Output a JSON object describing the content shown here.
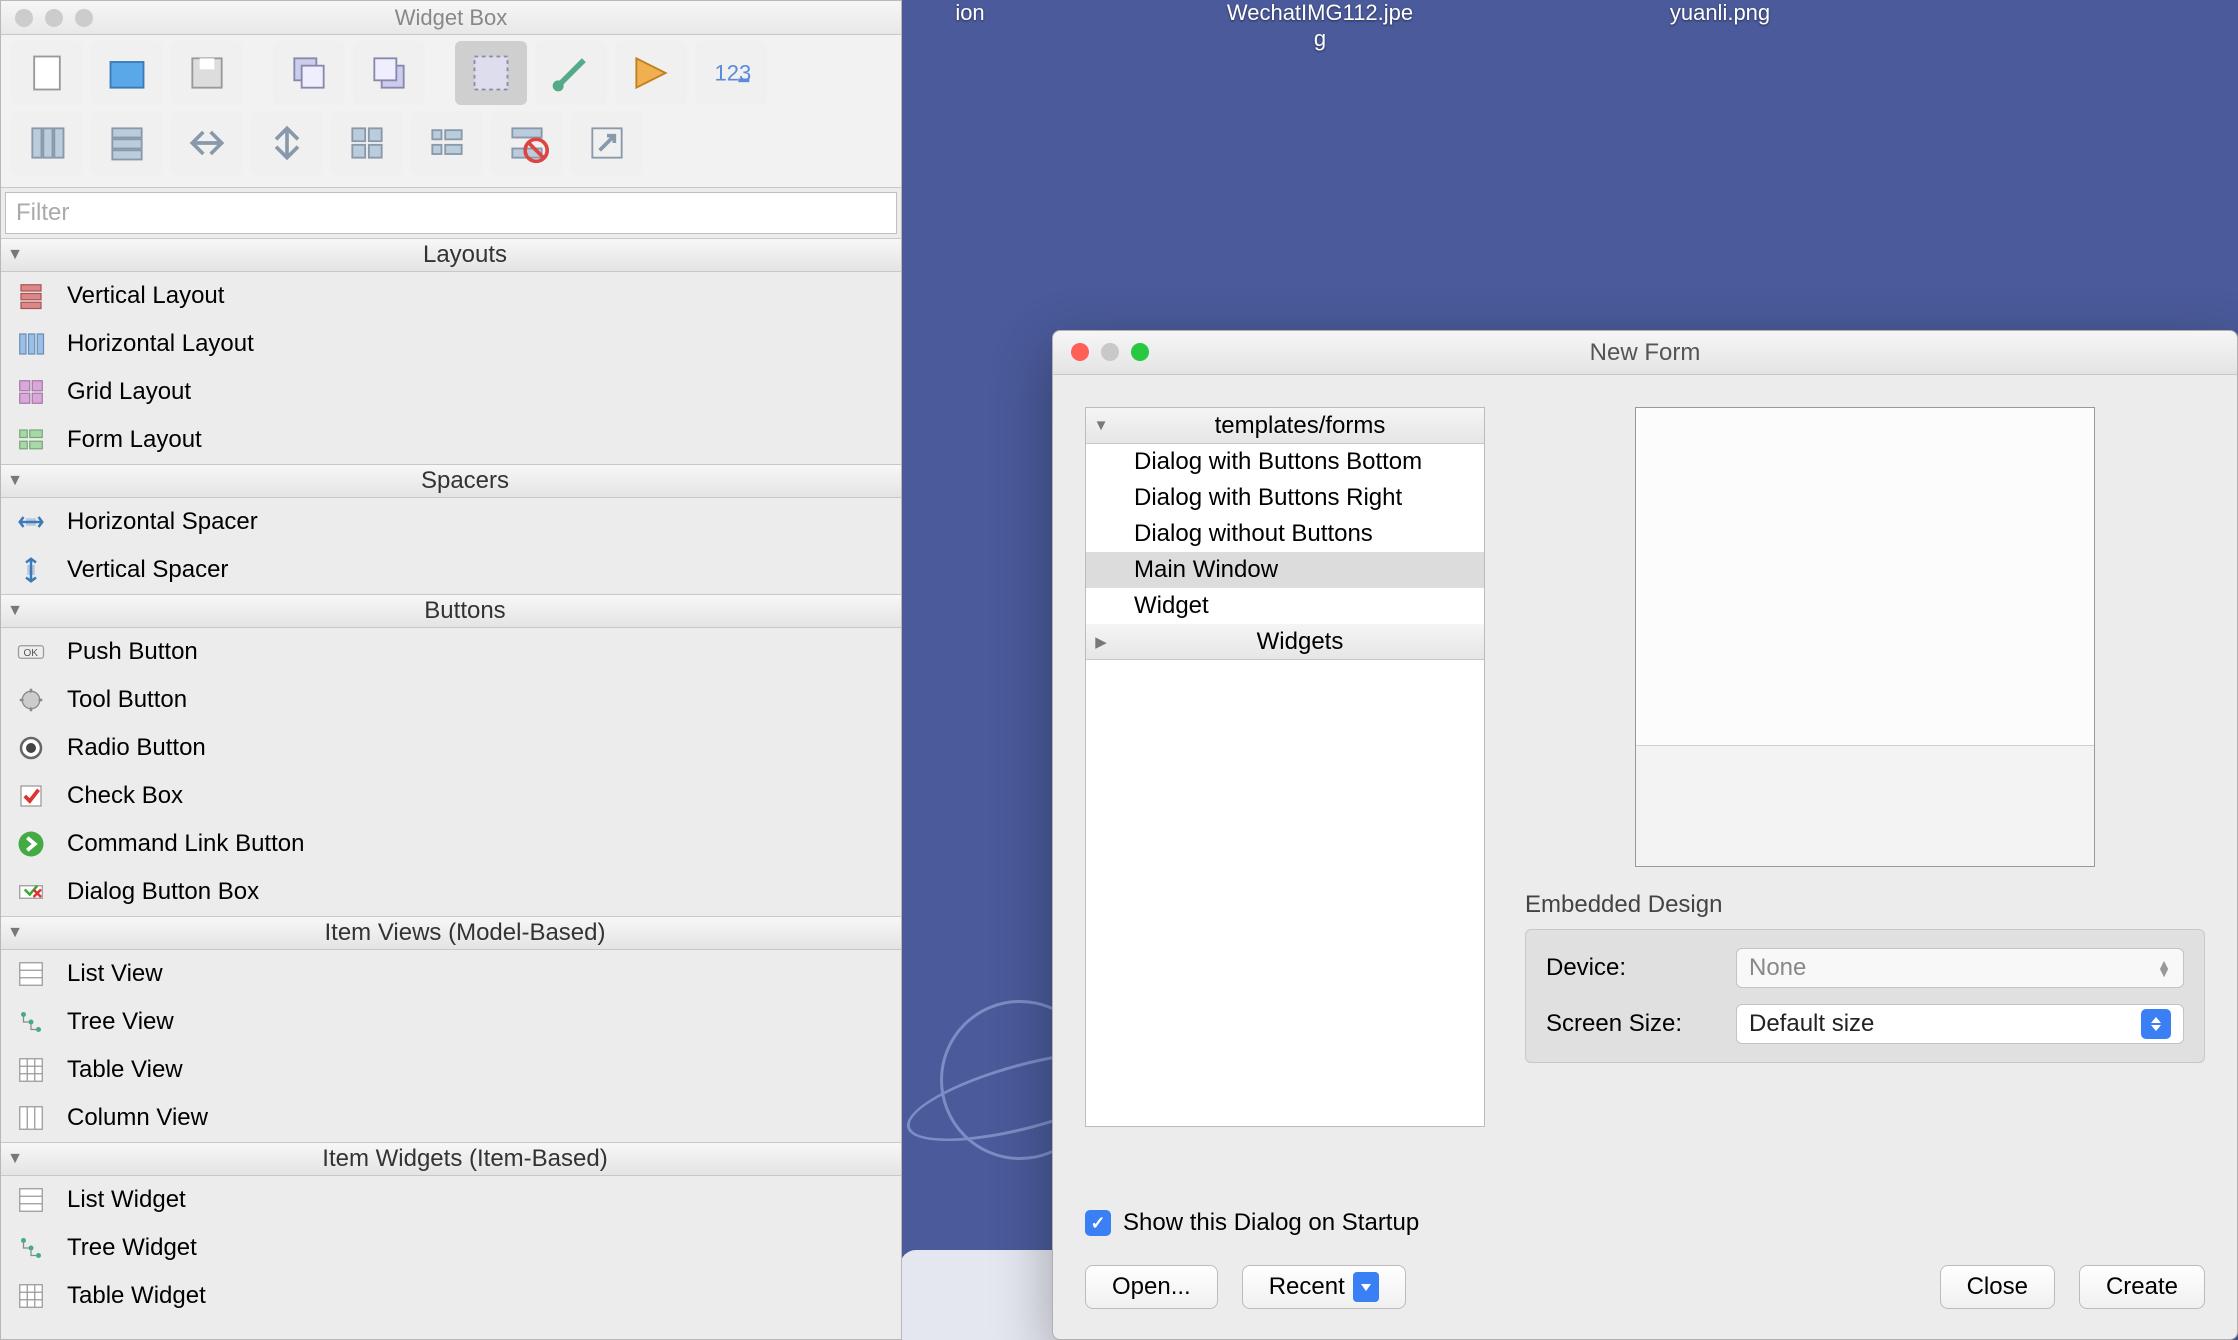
{
  "desktop": {
    "files": [
      {
        "name_top": "ion"
      },
      {
        "name_top": "WechatIMG112.jpe",
        "name_bot": "g"
      },
      {
        "name_top": "yuanli.png"
      }
    ]
  },
  "widget_window": {
    "title": "Widget Box",
    "filter_placeholder": "Filter",
    "categories": [
      {
        "name": "Layouts",
        "items": [
          "Vertical Layout",
          "Horizontal Layout",
          "Grid Layout",
          "Form Layout"
        ]
      },
      {
        "name": "Spacers",
        "items": [
          "Horizontal Spacer",
          "Vertical Spacer"
        ]
      },
      {
        "name": "Buttons",
        "items": [
          "Push Button",
          "Tool Button",
          "Radio Button",
          "Check Box",
          "Command Link Button",
          "Dialog Button Box"
        ]
      },
      {
        "name": "Item Views (Model-Based)",
        "items": [
          "List View",
          "Tree View",
          "Table View",
          "Column View"
        ]
      },
      {
        "name": "Item Widgets (Item-Based)",
        "items": [
          "List Widget",
          "Tree Widget",
          "Table Widget"
        ]
      }
    ]
  },
  "dialog": {
    "title": "New Form",
    "tree_header": "templates/forms",
    "tree_items": [
      "Dialog with Buttons Bottom",
      "Dialog with Buttons Right",
      "Dialog without Buttons",
      "Main Window",
      "Widget"
    ],
    "tree_selected": "Main Window",
    "tree_header2": "Widgets",
    "embedded_title": "Embedded Design",
    "device_label": "Device:",
    "device_value": "None",
    "size_label": "Screen Size:",
    "size_value": "Default size",
    "checkbox_label": "Show this Dialog on Startup",
    "buttons": {
      "open": "Open...",
      "recent": "Recent",
      "close": "Close",
      "create": "Create"
    }
  }
}
